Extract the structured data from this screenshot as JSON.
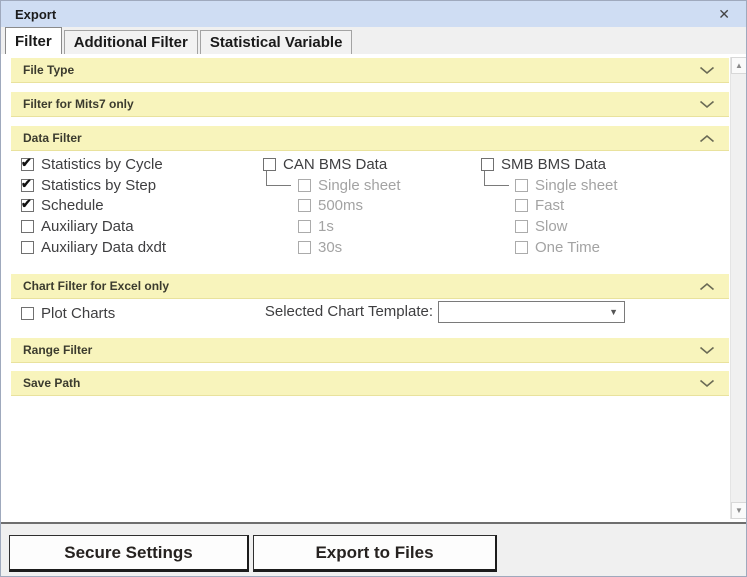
{
  "window": {
    "title": "Export"
  },
  "icons": {
    "close": "✕",
    "checkmark": "✔",
    "combo_arrow": "▼",
    "scroll_up": "▲",
    "scroll_down": "▼"
  },
  "tabs": [
    {
      "label": "Filter",
      "active": true
    },
    {
      "label": "Additional Filter",
      "active": false
    },
    {
      "label": "Statistical Variable",
      "active": false
    }
  ],
  "sections": {
    "file_type": {
      "label": "File Type",
      "state": "collapsed"
    },
    "mits7": {
      "label": "Filter for Mits7 only",
      "state": "collapsed"
    },
    "data_filter": {
      "label": "Data Filter",
      "state": "expanded"
    },
    "chart_filter": {
      "label": "Chart Filter for Excel only",
      "state": "expanded"
    },
    "range_filter": {
      "label": "Range Filter",
      "state": "collapsed"
    },
    "save_path": {
      "label": "Save Path",
      "state": "collapsed"
    }
  },
  "data_filter": {
    "left": [
      {
        "label": "Statistics by Cycle",
        "checked": true
      },
      {
        "label": "Statistics by Step",
        "checked": true
      },
      {
        "label": "Schedule",
        "checked": true
      },
      {
        "label": "Auxiliary Data",
        "checked": false
      },
      {
        "label": "Auxiliary Data dxdt",
        "checked": false
      }
    ],
    "can_group": {
      "label": "CAN BMS Data",
      "checked": false,
      "children": [
        {
          "label": "Single sheet",
          "checked": false
        },
        {
          "label": "500ms",
          "checked": false
        },
        {
          "label": "1s",
          "checked": false
        },
        {
          "label": "30s",
          "checked": false
        }
      ]
    },
    "smb_group": {
      "label": "SMB BMS Data",
      "checked": false,
      "children": [
        {
          "label": "Single sheet",
          "checked": false
        },
        {
          "label": "Fast",
          "checked": false
        },
        {
          "label": "Slow",
          "checked": false
        },
        {
          "label": "One Time",
          "checked": false
        }
      ]
    }
  },
  "chart_filter": {
    "plot_charts": {
      "label": "Plot Charts",
      "checked": false
    },
    "template_label": "Selected Chart Template:",
    "template_value": ""
  },
  "footer": {
    "secure_button": "Secure Settings",
    "export_button": "Export to Files"
  },
  "colors": {
    "accent_yellow": "#f8f4bc",
    "titlebar_blue": "#cfddf3",
    "header_text": "#3b3b2e",
    "disabled_text": "#a3a3a3"
  }
}
